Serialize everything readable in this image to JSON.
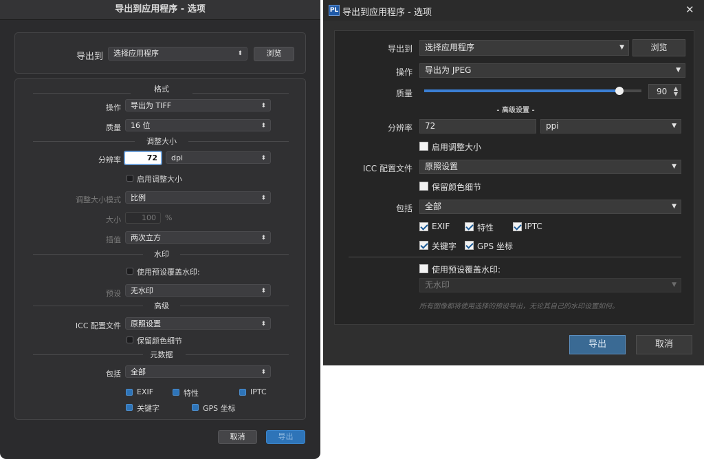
{
  "left_dialog": {
    "title": "导出到应用程序 - 选项",
    "export_to_label": "导出到",
    "export_to_value": "选择应用程序",
    "browse_label": "浏览",
    "format_header": "格式",
    "operation_label": "操作",
    "operation_value": "导出为 TIFF",
    "quality_label": "质量",
    "quality_value": "16 位",
    "resize_header": "调整大小",
    "resolution_label": "分辨率",
    "resolution_value": "72",
    "resolution_unit": "dpi",
    "enable_resize_label": "启用调整大小",
    "resize_mode_label": "调整大小模式",
    "resize_mode_value": "比例",
    "size_label": "大小",
    "size_value": "100",
    "size_unit": "%",
    "interp_label": "插值",
    "interp_value": "两次立方",
    "watermark_header": "水印",
    "use_watermark_label": "使用预设覆盖水印:",
    "preset_label": "预设",
    "preset_value": "无水印",
    "advanced_header": "高级",
    "icc_label": "ICC 配置文件",
    "icc_value": "原照设置",
    "preserve_color_label": "保留颜色细节",
    "metadata_header": "元数据",
    "include_label": "包括",
    "include_value": "全部",
    "meta": {
      "exif": "EXIF",
      "props": "特性",
      "iptc": "IPTC",
      "keywords": "关键字",
      "gps": "GPS 坐标"
    },
    "cancel_label": "取消",
    "export_label": "导出"
  },
  "right_dialog": {
    "logo_text": "PL",
    "title": "导出到应用程序 - 选项",
    "close_glyph": "✕",
    "export_to_label": "导出到",
    "export_to_value": "选择应用程序",
    "browse_label": "浏览",
    "operation_label": "操作",
    "operation_value": "导出为 JPEG",
    "quality_label": "质量",
    "quality_value": "90",
    "quality_fraction": 0.9,
    "advanced_header": "- 高级设置 -",
    "resolution_label": "分辨率",
    "resolution_value": "72",
    "resolution_unit": "ppi",
    "enable_resize_label": "启用调整大小",
    "icc_label": "ICC 配置文件",
    "icc_value": "原照设置",
    "preserve_color_label": "保留颜色细节",
    "include_label": "包括",
    "include_value": "全部",
    "meta": {
      "exif": "EXIF",
      "props": "特性",
      "iptc": "IPTC",
      "keywords": "关键字",
      "gps": "GPS 坐标"
    },
    "use_watermark_label": "使用预设覆盖水印:",
    "watermark_value": "无水印",
    "watermark_note": "所有图像都将使用选择的预设导出，无论其自己的水印设置如何。",
    "export_label": "导出",
    "cancel_label": "取消"
  },
  "colors": {
    "accent_blue": "#2e74b8",
    "dialog_bg": "#2b2b2d"
  }
}
